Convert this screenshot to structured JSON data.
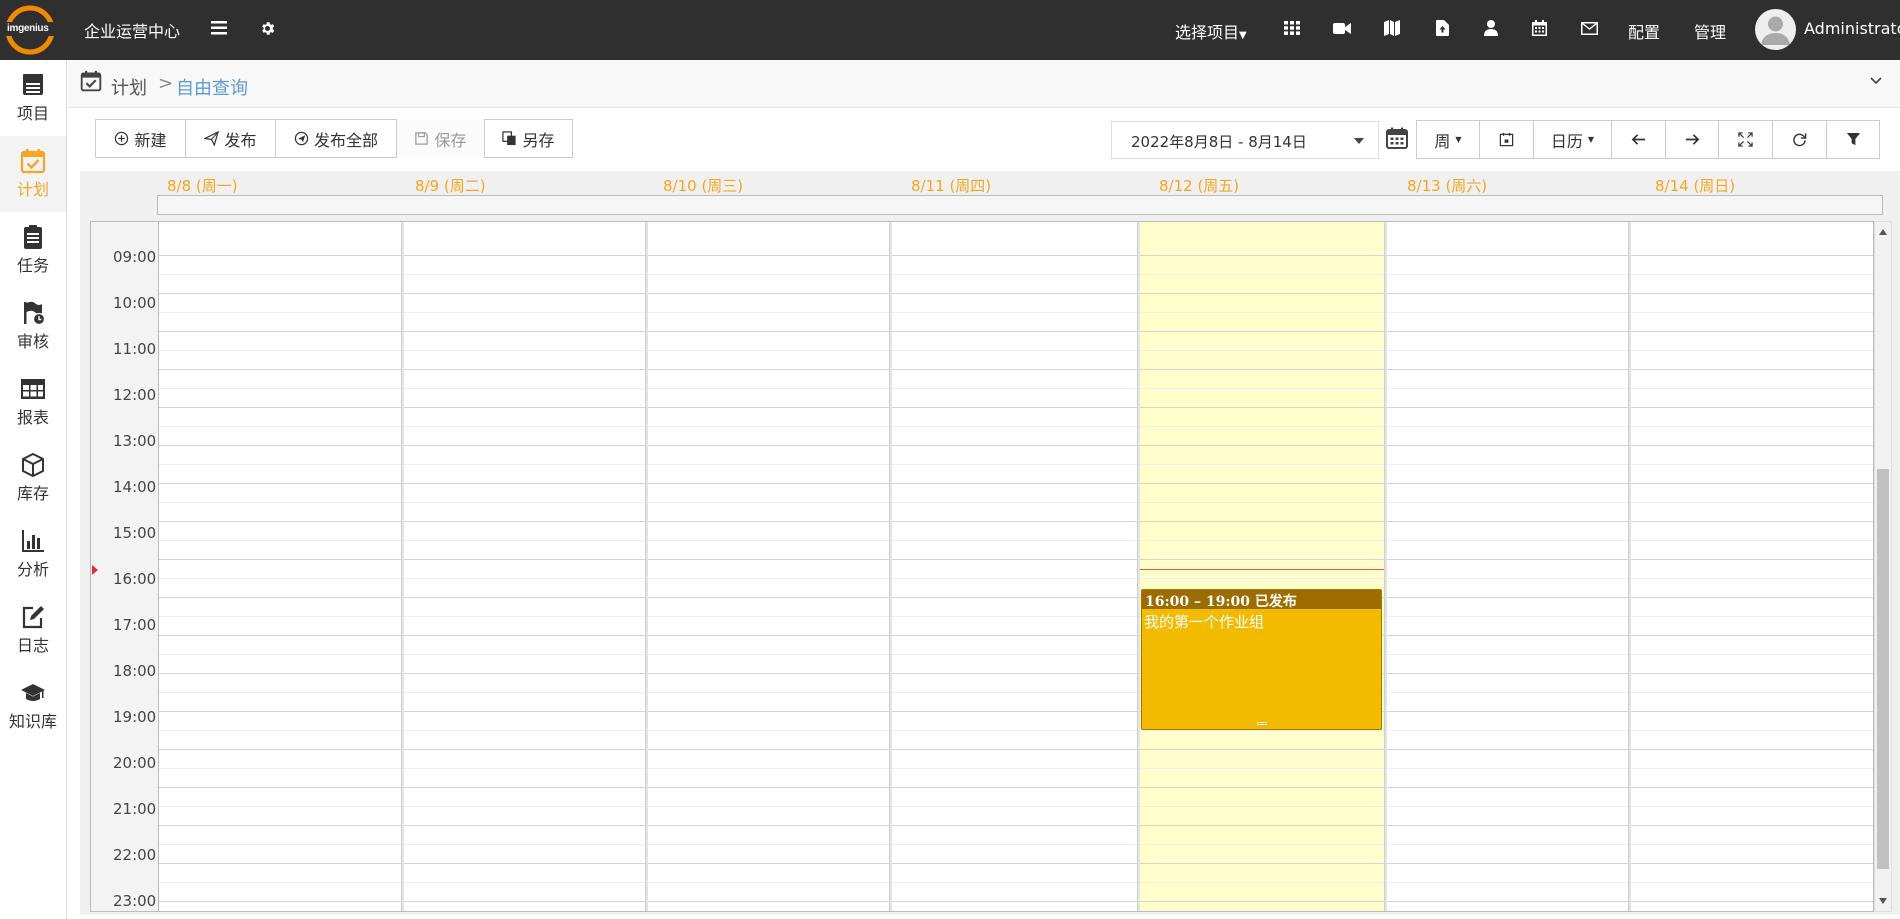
{
  "header": {
    "logo_text": "imgenius",
    "app_title": "企业运营中心",
    "project_select": "选择项目",
    "config_label": "配置",
    "admin_label": "管理",
    "username": "Administrator",
    "icons": [
      "menu-icon",
      "gear-icon",
      "grid-icon",
      "video-icon",
      "map-icon",
      "upload-file-icon",
      "user-icon",
      "calendar-icon",
      "mail-icon"
    ]
  },
  "sidebar": {
    "items": [
      {
        "label": "项目",
        "icon": "project-icon",
        "active": false
      },
      {
        "label": "计划",
        "icon": "plan-calendar-icon",
        "active": true
      },
      {
        "label": "任务",
        "icon": "task-clipboard-icon",
        "active": false
      },
      {
        "label": "审核",
        "icon": "review-flag-icon",
        "active": false
      },
      {
        "label": "报表",
        "icon": "report-table-icon",
        "active": false
      },
      {
        "label": "库存",
        "icon": "inventory-box-icon",
        "active": false
      },
      {
        "label": "分析",
        "icon": "analysis-chart-icon",
        "active": false
      },
      {
        "label": "日志",
        "icon": "log-edit-icon",
        "active": false
      },
      {
        "label": "知识库",
        "icon": "knowledge-cap-icon",
        "active": false
      }
    ]
  },
  "breadcrumb": {
    "root": "计划",
    "separator": ">",
    "current": "自由查询"
  },
  "toolbar": {
    "new_label": "新建",
    "publish_label": "发布",
    "publish_all_label": "发布全部",
    "save_label": "保存",
    "save_as_label": "另存",
    "date_range": "2022年8月8日 - 8月14日",
    "week_label": "周",
    "calendar_label": "日历"
  },
  "calendar": {
    "days": [
      "8/8 (周一)",
      "8/9 (周二)",
      "8/10 (周三)",
      "8/11 (周四)",
      "8/12 (周五)",
      "8/13 (周六)",
      "8/14 (周日)"
    ],
    "today_index": 4,
    "hours": [
      "09:00",
      "10:00",
      "11:00",
      "12:00",
      "13:00",
      "14:00",
      "15:00",
      "16:00",
      "17:00",
      "18:00",
      "19:00",
      "20:00",
      "21:00",
      "22:00",
      "23:00"
    ],
    "events": [
      {
        "time": "16:00 – 19:00 已发布",
        "title": "我的第一个作业组",
        "day_index": 4,
        "color": "#f2bb00",
        "header_color": "#9c6c00"
      }
    ],
    "accent_color": "#f5a623",
    "today_color": "#fefdcc"
  }
}
